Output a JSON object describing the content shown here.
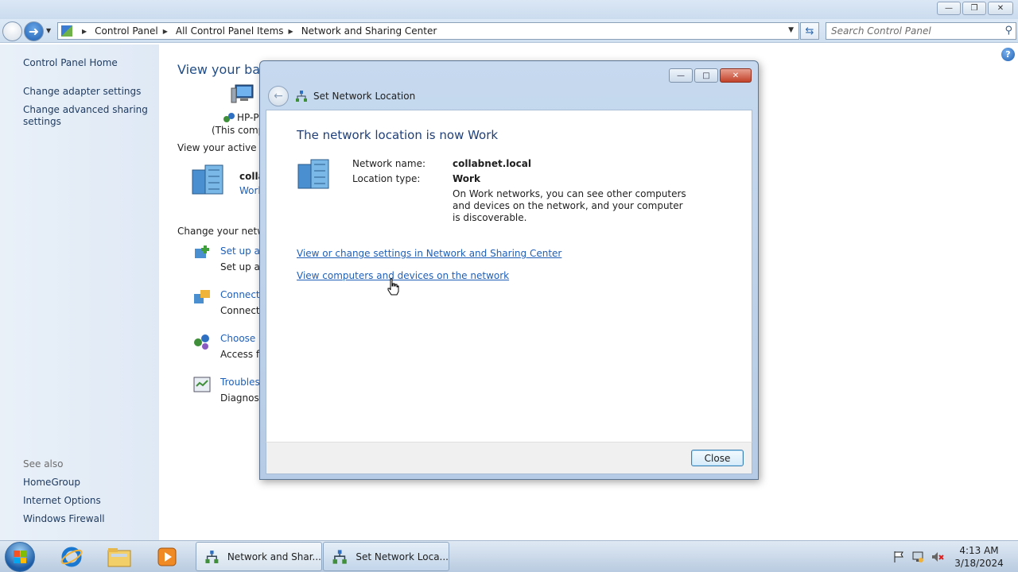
{
  "address_bar": {
    "crumbs": [
      "Control Panel",
      "All Control Panel Items",
      "Network and Sharing Center"
    ]
  },
  "search": {
    "placeholder": "Search Control Panel"
  },
  "left_pane": {
    "home": "Control Panel Home",
    "adapter": "Change adapter settings",
    "advanced_1": "Change advanced sharing",
    "advanced_2": "settings",
    "see_also": "See also",
    "homegroup": "HomeGroup",
    "internet_options": "Internet Options",
    "firewall": "Windows Firewall"
  },
  "main_pane": {
    "heading": "View your basi",
    "computer_name": "HP-P",
    "computer_sub": "(This comp",
    "active_networks": "View your active ne",
    "network_name": "colla",
    "network_type": "Work",
    "change_settings": "Change your netwo",
    "tasks": [
      {
        "title": "Set up a n",
        "desc": "Set up a v"
      },
      {
        "title": "Connect t",
        "desc": "Connect"
      },
      {
        "title": "Choose h",
        "desc": "Access fil"
      },
      {
        "title": "Troublesh",
        "desc": "Diagnose"
      }
    ]
  },
  "dialog": {
    "title": "Set Network Location",
    "heading": "The network location is now Work",
    "network_name_label": "Network name:",
    "network_name_value": "collabnet.local",
    "location_type_label": "Location type:",
    "location_type_value": "Work",
    "description": "On Work networks, you can see other computers and devices on the network, and your computer is discoverable.",
    "link_settings": "View or change settings in Network and Sharing Center",
    "link_devices": "View computers and devices on the network",
    "close_button": "Close"
  },
  "taskbar": {
    "tasks": [
      {
        "label": "Network and Shar..."
      },
      {
        "label": "Set Network Loca..."
      }
    ],
    "clock_time": "4:13 AM",
    "clock_date": "3/18/2024"
  }
}
